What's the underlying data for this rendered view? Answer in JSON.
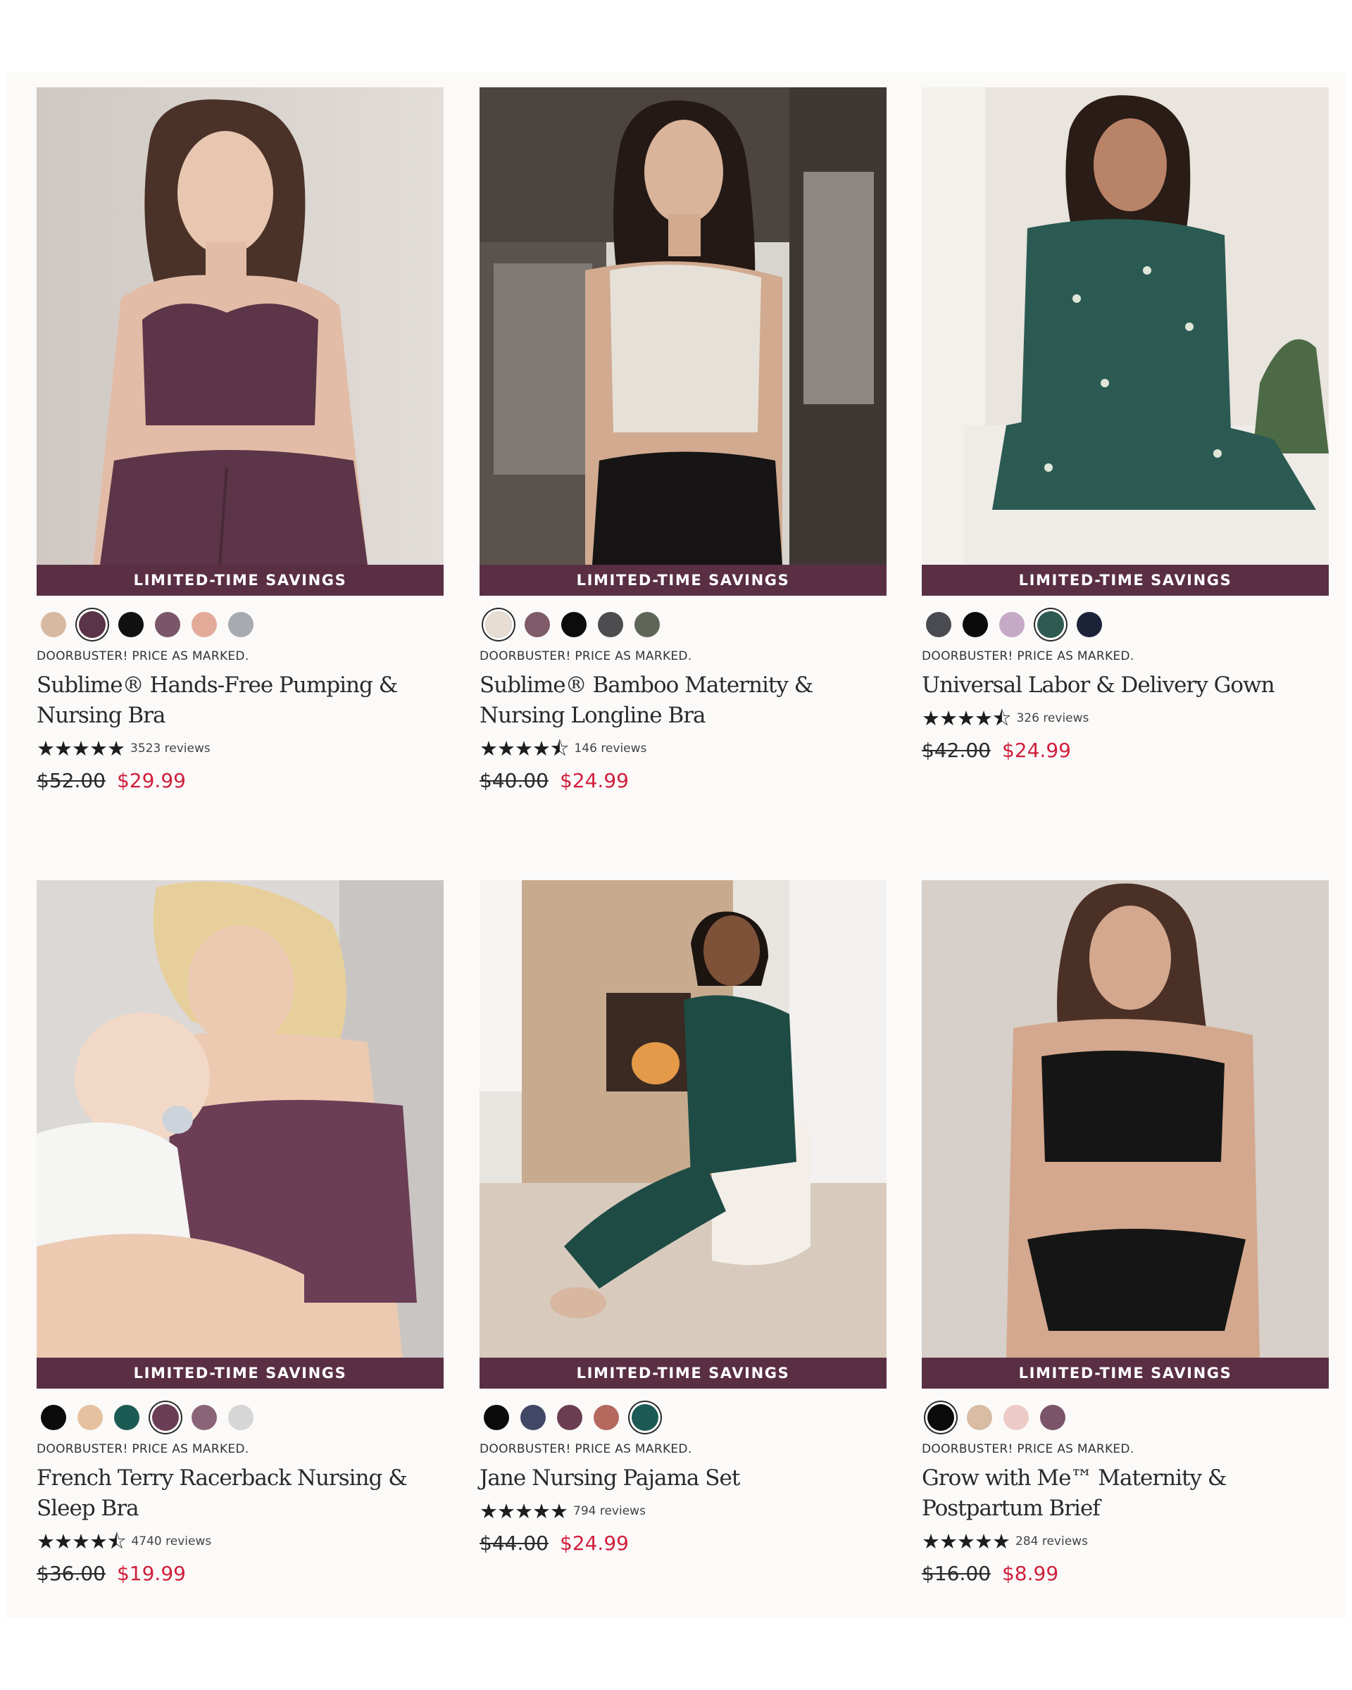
{
  "products": [
    {
      "ribbon": "LIMITED-TIME SAVINGS",
      "badge": "DOORBUSTER! PRICE AS MARKED.",
      "title": "Sublime® Hands-Free Pumping & Nursing Bra",
      "stars": "★★★★★",
      "reviews": "3523 reviews",
      "original_price": "$52.00",
      "sale_price": "$29.99",
      "rating": 5,
      "swatches": [
        "#d7b9a2",
        "#5a3447",
        "#111111",
        "#7b5668",
        "#e3aa9a",
        "#a7aab0"
      ],
      "selected_swatch": 1,
      "photo": "woman-plum-pumping-bra"
    },
    {
      "ribbon": "LIMITED-TIME SAVINGS",
      "badge": "DOORBUSTER! PRICE AS MARKED.",
      "title": "Sublime® Bamboo Maternity & Nursing Longline Bra",
      "stars": "★★★★⯪",
      "reviews": "146 reviews",
      "original_price": "$40.00",
      "sale_price": "$24.99",
      "rating": 4.5,
      "swatches": [
        "#e7ddd2",
        "#7f5b6a",
        "#0c0c0c",
        "#4d4d4f",
        "#5f6657"
      ],
      "selected_swatch": 0,
      "photo": "woman-oatmeal-longline-bra"
    },
    {
      "ribbon": "LIMITED-TIME SAVINGS",
      "badge": "DOORBUSTER! PRICE AS MARKED.",
      "title": "Universal Labor & Delivery Gown",
      "stars": "★★★★⯪",
      "reviews": "326 reviews",
      "original_price": "$42.00",
      "sale_price": "$24.99",
      "rating": 4.5,
      "swatches": [
        "#4a4b51",
        "#0b0b0b",
        "#c6a9c7",
        "#2f5a52",
        "#1a2338"
      ],
      "selected_swatch": 3,
      "photo": "pregnant-woman-green-gown"
    },
    {
      "ribbon": "LIMITED-TIME SAVINGS",
      "badge": "DOORBUSTER! PRICE AS MARKED.",
      "title": "French Terry Racerback Nursing & Sleep Bra",
      "stars": "★★★★⯪",
      "reviews": "4740 reviews",
      "original_price": "$36.00",
      "sale_price": "$19.99",
      "rating": 4.5,
      "swatches": [
        "#0b0b0b",
        "#e6c19f",
        "#1c5b53",
        "#6a3e54",
        "#8a6577",
        "#d6d6d6"
      ],
      "selected_swatch": 3,
      "photo": "mother-baby-plum-sleep-bra"
    },
    {
      "ribbon": "LIMITED-TIME SAVINGS",
      "badge": "DOORBUSTER! PRICE AS MARKED.",
      "title": "Jane Nursing Pajama Set",
      "stars": "★★★★★",
      "reviews": "794 reviews",
      "original_price": "$44.00",
      "sale_price": "$24.99",
      "rating": 5,
      "swatches": [
        "#0b0b0b",
        "#414866",
        "#6b3d50",
        "#b4685e",
        "#1e5a55"
      ],
      "selected_swatch": 4,
      "photo": "woman-green-pajama-set-fireplace"
    },
    {
      "ribbon": "LIMITED-TIME SAVINGS",
      "badge": "DOORBUSTER! PRICE AS MARKED.",
      "title": "Grow with Me™ Maternity & Postpartum Brief",
      "stars": "★★★★★",
      "reviews": "284 reviews",
      "original_price": "$16.00",
      "sale_price": "$8.99",
      "rating": 5,
      "swatches": [
        "#0b0b0b",
        "#d9bca4",
        "#eccbc6",
        "#7a5468"
      ],
      "selected_swatch": 0,
      "photo": "woman-black-bra-brief"
    }
  ]
}
